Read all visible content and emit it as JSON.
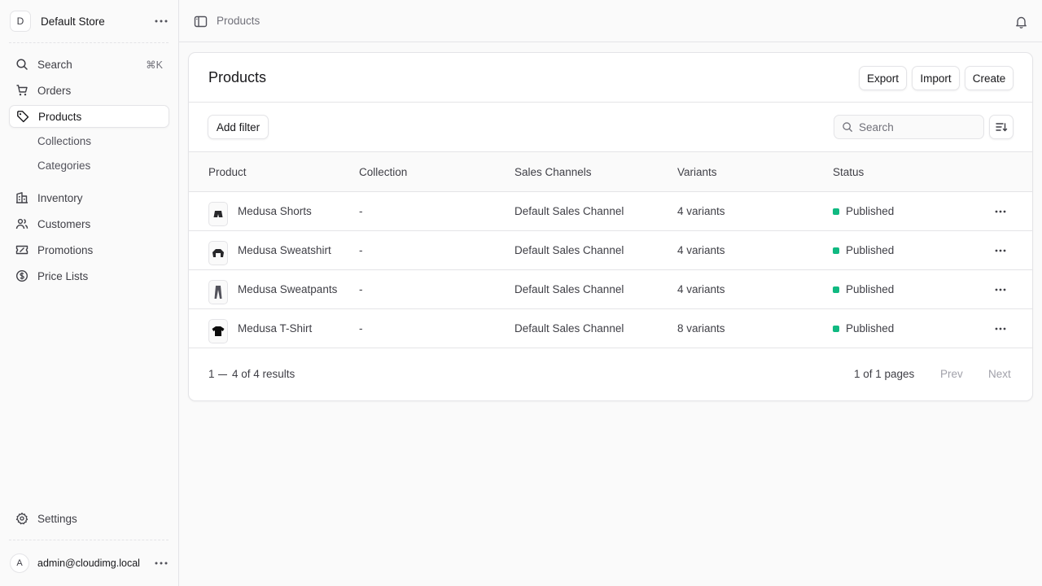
{
  "store": {
    "initial": "D",
    "name": "Default Store"
  },
  "nav": {
    "search": {
      "label": "Search",
      "shortcut": "⌘K"
    },
    "orders": "Orders",
    "products": "Products",
    "collections": "Collections",
    "categories": "Categories",
    "inventory": "Inventory",
    "customers": "Customers",
    "promotions": "Promotions",
    "price_lists": "Price Lists",
    "settings": "Settings"
  },
  "user": {
    "initial": "A",
    "email": "admin@cloudimg.local"
  },
  "breadcrumb": "Products",
  "page": {
    "title": "Products",
    "export_label": "Export",
    "import_label": "Import",
    "create_label": "Create",
    "add_filter_label": "Add filter",
    "search_placeholder": "Search"
  },
  "table": {
    "columns": [
      "Product",
      "Collection",
      "Sales Channels",
      "Variants",
      "Status"
    ],
    "rows": [
      {
        "product": "Medusa Shorts",
        "thumb": "shorts-icon",
        "collection": "-",
        "channel": "Default Sales Channel",
        "variants": "4 variants",
        "status": "Published"
      },
      {
        "product": "Medusa Sweatshirt",
        "thumb": "sweatshirt-icon",
        "collection": "-",
        "channel": "Default Sales Channel",
        "variants": "4 variants",
        "status": "Published"
      },
      {
        "product": "Medusa Sweatpants",
        "thumb": "sweatpants-icon",
        "collection": "-",
        "channel": "Default Sales Channel",
        "variants": "4 variants",
        "status": "Published"
      },
      {
        "product": "Medusa T-Shirt",
        "thumb": "tshirt-icon",
        "collection": "-",
        "channel": "Default Sales Channel",
        "variants": "8 variants",
        "status": "Published"
      }
    ]
  },
  "pagination": {
    "range_start": "1",
    "range_rest": "4 of 4 results",
    "pages": "1 of 1 pages",
    "prev": "Prev",
    "next": "Next"
  },
  "colors": {
    "published": "#10b981",
    "border": "#e4e4e7",
    "muted_text": "#71717a"
  }
}
